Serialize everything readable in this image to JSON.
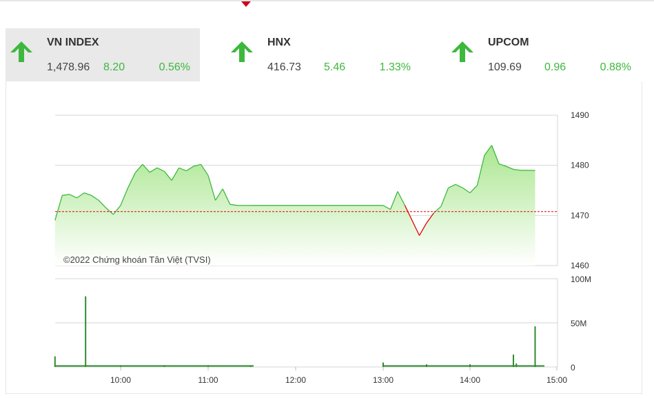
{
  "tabs": [
    {
      "name": "VN INDEX",
      "value": "1,478.96",
      "change": "8.20",
      "percent": "0.56%",
      "active": true,
      "icon": "arrow-up-icon"
    },
    {
      "name": "HNX",
      "value": "416.73",
      "change": "5.46",
      "percent": "1.33%",
      "active": false,
      "icon": "arrow-up-icon"
    },
    {
      "name": "UPCOM",
      "value": "109.69",
      "change": "0.96",
      "percent": "0.88%",
      "active": false,
      "icon": "arrow-up-icon"
    }
  ],
  "colors": {
    "up": "#3db83d",
    "down": "#e00000",
    "area_top": "#a5e58a",
    "volume": "#2e8b2e"
  },
  "chart_data": [
    {
      "type": "area",
      "series": [],
      "reference": 1470.76,
      "x": [
        "09:15",
        "09:20",
        "09:25",
        "09:30",
        "09:35",
        "09:40",
        "09:45",
        "09:50",
        "09:55",
        "10:00",
        "10:05",
        "10:10",
        "10:15",
        "10:20",
        "10:25",
        "10:30",
        "10:35",
        "10:40",
        "10:45",
        "10:50",
        "10:55",
        "11:00",
        "11:05",
        "11:10",
        "11:15",
        "11:20",
        "11:25",
        "11:30",
        "13:00",
        "13:05",
        "13:10",
        "13:15",
        "13:20",
        "13:25",
        "13:30",
        "13:35",
        "13:40",
        "13:45",
        "13:50",
        "13:55",
        "14:00",
        "14:05",
        "14:10",
        "14:15",
        "14:20",
        "14:25",
        "14:30",
        "14:35",
        "14:40",
        "14:45"
      ],
      "values": [
        1469.0,
        1474.0,
        1474.2,
        1473.5,
        1474.5,
        1474.0,
        1473.0,
        1471.5,
        1470.2,
        1472.0,
        1475.5,
        1478.5,
        1480.2,
        1478.6,
        1479.5,
        1478.8,
        1477.0,
        1479.5,
        1478.9,
        1479.8,
        1480.2,
        1478.0,
        1473.0,
        1475.3,
        1472.2,
        1472.0,
        1472.0,
        1472.0,
        1472.0,
        1471.2,
        1474.8,
        1472.0,
        1469.0,
        1466.0,
        1468.5,
        1470.5,
        1471.8,
        1475.5,
        1476.2,
        1475.5,
        1474.5,
        1476.0,
        1482.0,
        1484.0,
        1480.3,
        1479.8,
        1479.2,
        1479.0,
        1479.0,
        1478.96
      ],
      "yticks": [
        "1490",
        "1480",
        "1470",
        "1460"
      ],
      "ylim": [
        1460,
        1490
      ],
      "xticks": [
        "10:00",
        "11:00",
        "12:00",
        "13:00",
        "14:00",
        "15:00"
      ],
      "annotation": "©2022 Chứng khoán Tân Việt (TVSI)"
    },
    {
      "type": "bar",
      "series": [],
      "x": [
        "09:15",
        "09:36",
        "10:00",
        "10:30",
        "11:00",
        "11:29",
        "13:00",
        "13:30",
        "14:00",
        "14:30",
        "14:32",
        "14:45"
      ],
      "values": [
        12,
        80,
        2,
        2,
        2,
        2,
        5,
        3,
        3,
        14,
        4,
        46
      ],
      "yticks": [
        "100M",
        "50M",
        "0"
      ],
      "ylim": [
        0,
        100
      ],
      "xticks": [
        "10:00",
        "11:00",
        "12:00",
        "13:00",
        "14:00",
        "15:00"
      ]
    }
  ]
}
